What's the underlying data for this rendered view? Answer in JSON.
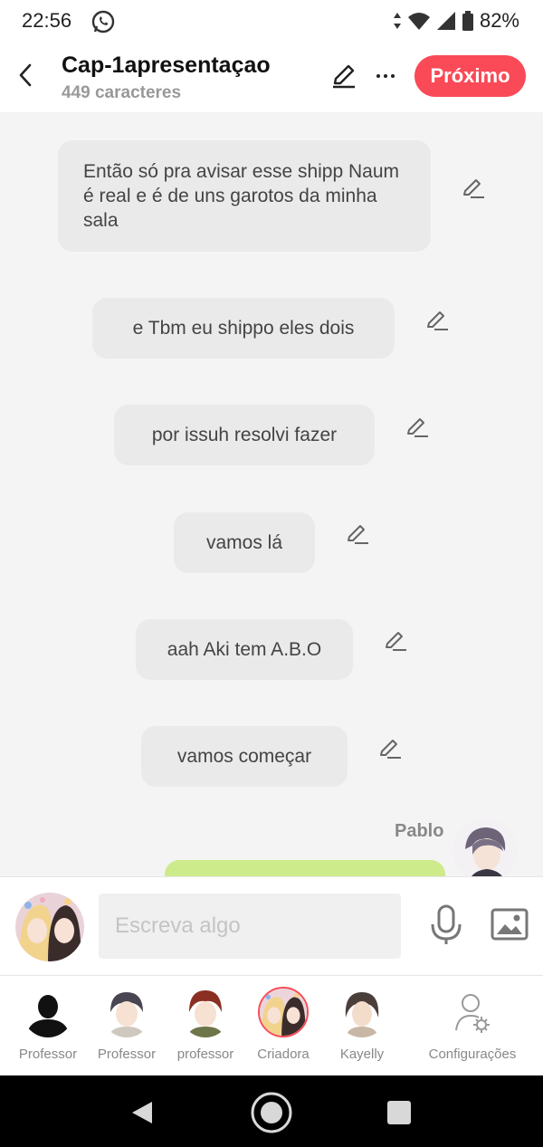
{
  "status": {
    "time": "22:56",
    "battery": "82%",
    "icons": [
      "whatsapp-icon",
      "vibrate-icon",
      "wifi-icon",
      "signal-icon",
      "battery-icon"
    ]
  },
  "header": {
    "title": "Cap-1apresentaçao",
    "subtitle": "449 caracteres",
    "next_label": "Próximo",
    "accent": "#fa4a57"
  },
  "messages": [
    {
      "text": "Então só pra avisar esse shipp Naum é real e é de uns garotos da minha sala"
    },
    {
      "text": "e Tbm eu shippo eles dois"
    },
    {
      "text": "por issuh resolvi fazer"
    },
    {
      "text": "vamos lá"
    },
    {
      "text": "aah Aki tem A.B.O"
    },
    {
      "text": "vamos começar"
    }
  ],
  "speaker": {
    "name": "Pablo"
  },
  "input": {
    "placeholder": "Escreva algo"
  },
  "characters": [
    {
      "label": "Professor"
    },
    {
      "label": "Professor"
    },
    {
      "label": "professor"
    },
    {
      "label": "Criadora"
    },
    {
      "label": "Kayelly"
    }
  ],
  "settings_label": "Configurações"
}
